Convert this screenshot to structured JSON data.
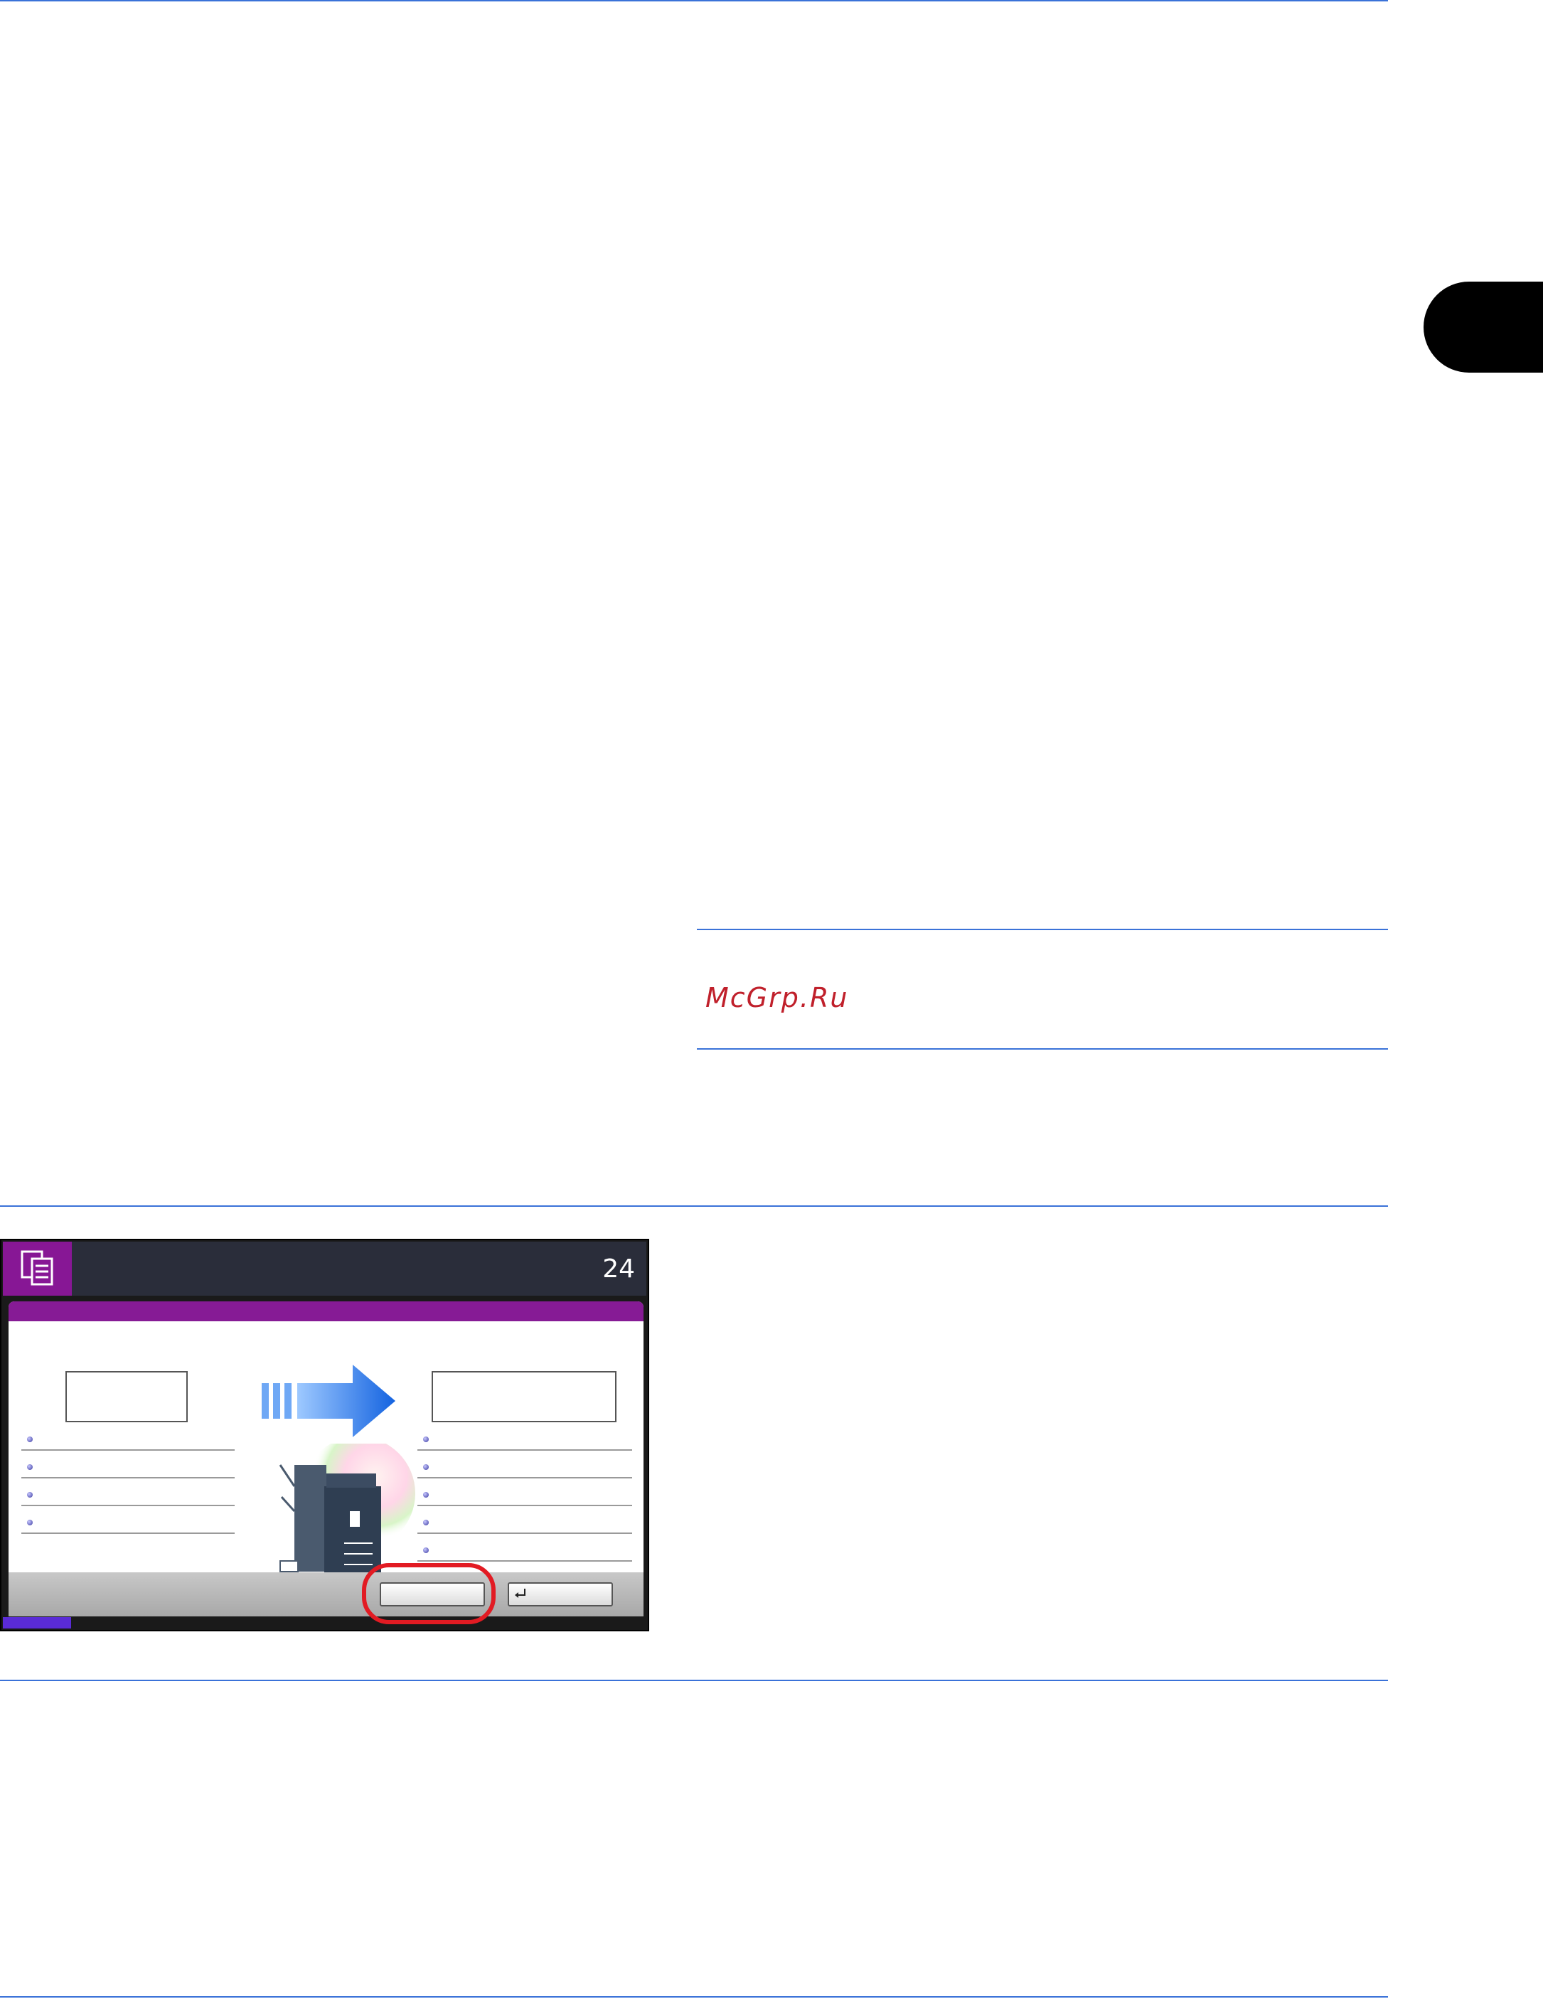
{
  "watermark": {
    "text": "McGrp.Ru"
  },
  "panel": {
    "page_count": "24",
    "icons": {
      "mode": "copy-icon",
      "enter": "enter-icon",
      "arrow": "arrow-right-icon",
      "device": "printer-icon"
    },
    "colors": {
      "title_bar": "#861b95",
      "mode_icon_bg": "#871795",
      "highlight": "#e21b23",
      "rules": "#3a72d8"
    }
  }
}
